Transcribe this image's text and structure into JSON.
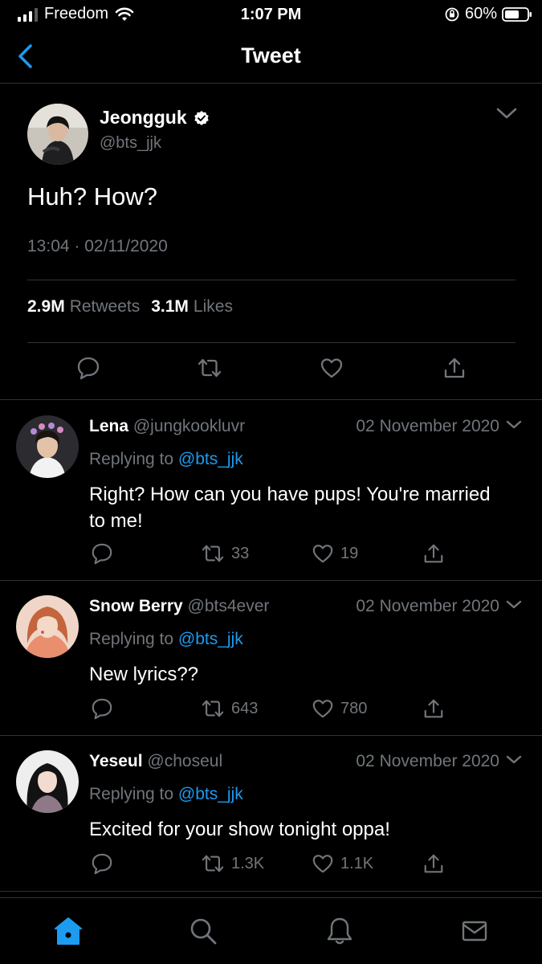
{
  "status_bar": {
    "carrier": "Freedom",
    "time": "1:07 PM",
    "battery": "60%"
  },
  "nav": {
    "title": "Tweet"
  },
  "main_tweet": {
    "name": "Jeongguk",
    "handle": "@bts_jjk",
    "text": "Huh? How?",
    "timestamp": "13:04 · 02/11/2020",
    "retweets_count": "2.9M",
    "retweets_label": "Retweets",
    "likes_count": "3.1M",
    "likes_label": "Likes"
  },
  "replies": [
    {
      "name": "Lena",
      "handle": "@jungkookluvr",
      "date": "02 November 2020",
      "replying_prefix": "Replying to",
      "replying_to": "@bts_jjk",
      "text": "Right? How can you have pups! You're married to me!",
      "retweets": "33",
      "likes": "19"
    },
    {
      "name": "Snow Berry",
      "handle": "@bts4ever",
      "date": "02 November 2020",
      "replying_prefix": "Replying to",
      "replying_to": "@bts_jjk",
      "text": "New lyrics??",
      "retweets": "643",
      "likes": "780"
    },
    {
      "name": "Yeseul",
      "handle": "@choseul",
      "date": "02 November 2020",
      "replying_prefix": "Replying to",
      "replying_to": "@bts_jjk",
      "text": "Excited for your show tonight oppa!",
      "retweets": "1.3K",
      "likes": "1.1K"
    }
  ],
  "tabbar": {
    "items": [
      "home-icon",
      "search-icon",
      "bell-icon",
      "mail-icon"
    ],
    "active": "home"
  },
  "colors": {
    "background": "#000000",
    "accent": "#1d9bf0",
    "muted": "#71767b",
    "divider": "#2f3336"
  }
}
